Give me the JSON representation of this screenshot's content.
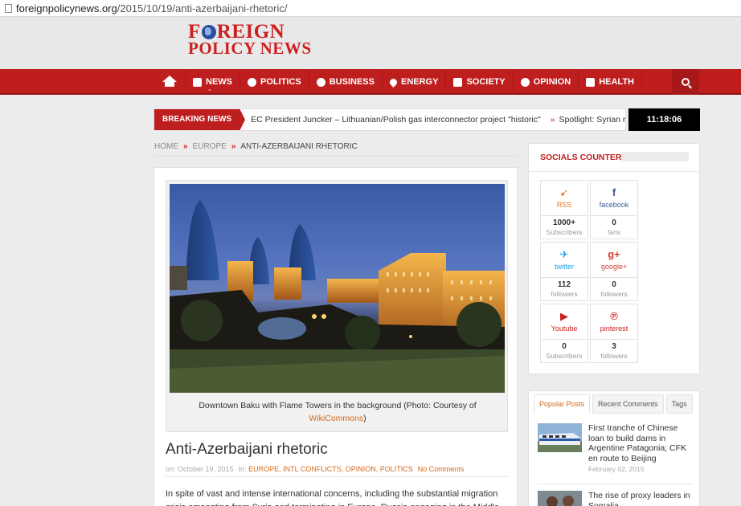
{
  "browser": {
    "url_host": "foreignpolicynews.org",
    "url_path": "/2015/10/19/anti-azerbaijani-rhetoric/"
  },
  "site": {
    "logo_line1_a": "F",
    "logo_line1_b": "REIGN",
    "logo_line2": "POLICY NEWS",
    "brand_color": "#cc1f1f"
  },
  "nav": {
    "items": [
      {
        "label": "NEWS",
        "icon": "newspaper-icon"
      },
      {
        "label": "POLITICS",
        "icon": "globe-icon"
      },
      {
        "label": "BUSINESS",
        "icon": "dollar-icon"
      },
      {
        "label": "ENERGY",
        "icon": "flame-icon"
      },
      {
        "label": "SOCIETY",
        "icon": "people-icon"
      },
      {
        "label": "OPINION",
        "icon": "speech-bubble-icon"
      },
      {
        "label": "HEALTH",
        "icon": "medkit-icon"
      }
    ]
  },
  "breaking": {
    "label": "BREAKING NEWS",
    "items": [
      "EC President Juncker – Lithuanian/Polish gas interconnector project \"historic\"",
      "Spotlight: Syrian rebels mo"
    ],
    "clock": "11:18:06"
  },
  "breadcrumb": {
    "home": "HOME",
    "section": "EUROPE",
    "current": "ANTI-AZERBAIJANI RHETORIC",
    "separator": "»"
  },
  "article": {
    "caption_text": "Downtown Baku with Flame Towers in the background (Photo: Courtesy of",
    "caption_link": "WikiCommons",
    "caption_end": ")",
    "title": "Anti-Azerbaijani rhetoric",
    "meta_on": "on: October 19, 2015",
    "meta_in": "In:",
    "categories": "EUROPE, INTL CONFLICTS, OPINION, POLITICS",
    "comments": "No Comments",
    "body": "In spite of vast and intense international concerns, including the substantial migration crisis emanating from Syria and terminating in Europe, Russia engaging in the Middle East with"
  },
  "socials": {
    "title": "SOCIALS COUNTER",
    "items": [
      {
        "network": "RSS",
        "count": "1000+",
        "unit": "Subscribers",
        "color": "#e8761c"
      },
      {
        "network": "facebook",
        "count": "0",
        "unit": "fans",
        "color": "#3b5998"
      },
      {
        "network": "twitter",
        "count": "112",
        "unit": "followers",
        "color": "#1da1f2"
      },
      {
        "network": "google+",
        "count": "0",
        "unit": "followers",
        "color": "#d6412f"
      },
      {
        "network": "Youtube",
        "count": "0",
        "unit": "Subscribers",
        "color": "#cc1f1f"
      },
      {
        "network": "pinterest",
        "count": "3",
        "unit": "followers",
        "color": "#cb2027"
      }
    ]
  },
  "tabs": {
    "labels": [
      "Popular Posts",
      "Recent Comments",
      "Tags"
    ],
    "posts": [
      {
        "title": "First tranche of Chinese loan to build dams in Argentine Patagonia; CFK en route to Beijing",
        "date": "February 02, 2015"
      },
      {
        "title": "The rise of proxy leaders in Somalia",
        "date": ""
      }
    ]
  }
}
